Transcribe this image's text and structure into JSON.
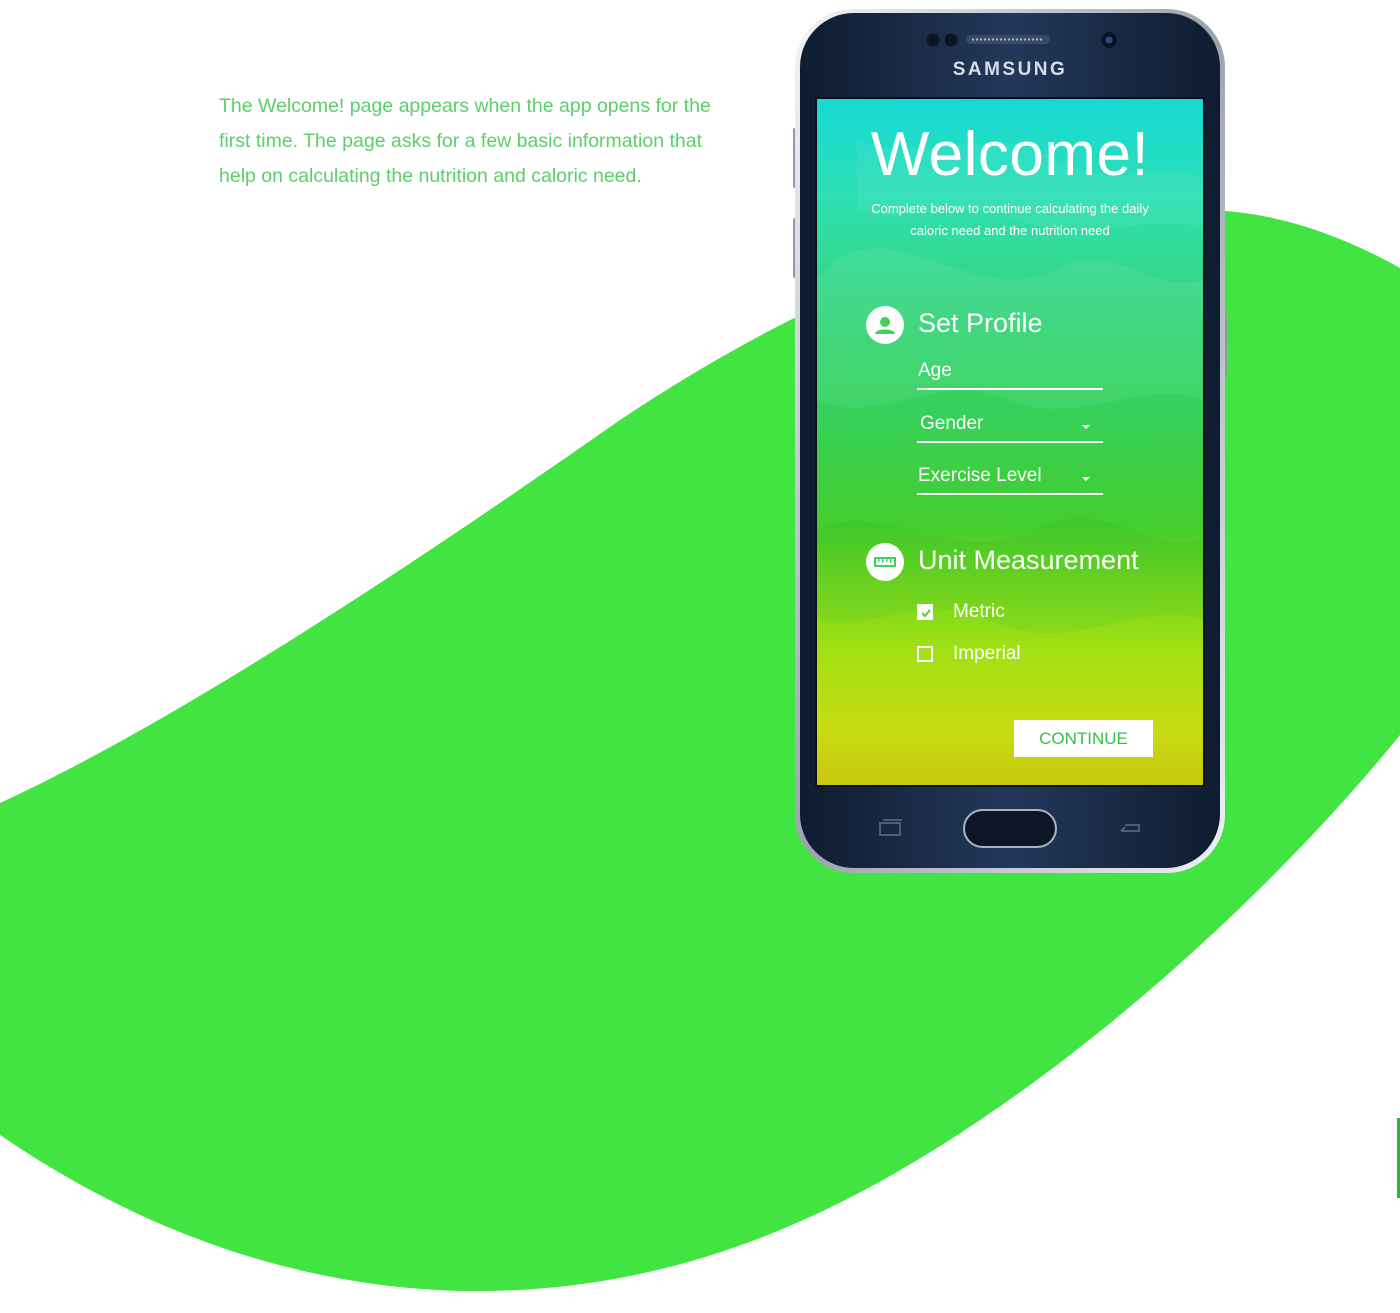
{
  "intro": {
    "text": "The Welcome! page appears when the app opens for the first time. The page asks for a few basic information that help on calculating the nutrition and caloric need."
  },
  "phone": {
    "brand": "SAMSUNG"
  },
  "app": {
    "title": "Welcome!",
    "subtitle": "Complete below to continue calculating the daily caloric need and the nutrition need",
    "profile": {
      "title": "Set Profile",
      "icon": "user-icon",
      "fields": {
        "age": "Age",
        "gender": "Gender",
        "exercise": "Exercise Level"
      }
    },
    "units": {
      "title": "Unit Measurement",
      "icon": "ruler-icon",
      "options": [
        {
          "label": "Metric",
          "checked": true
        },
        {
          "label": "Imperial",
          "checked": false
        }
      ]
    },
    "continue_label": "CONTINUE"
  },
  "colors": {
    "background_blob": "#41e441",
    "intro_text": "#5ccf6a",
    "continue_text": "#35c046",
    "phone_body": "#1a2a44"
  }
}
